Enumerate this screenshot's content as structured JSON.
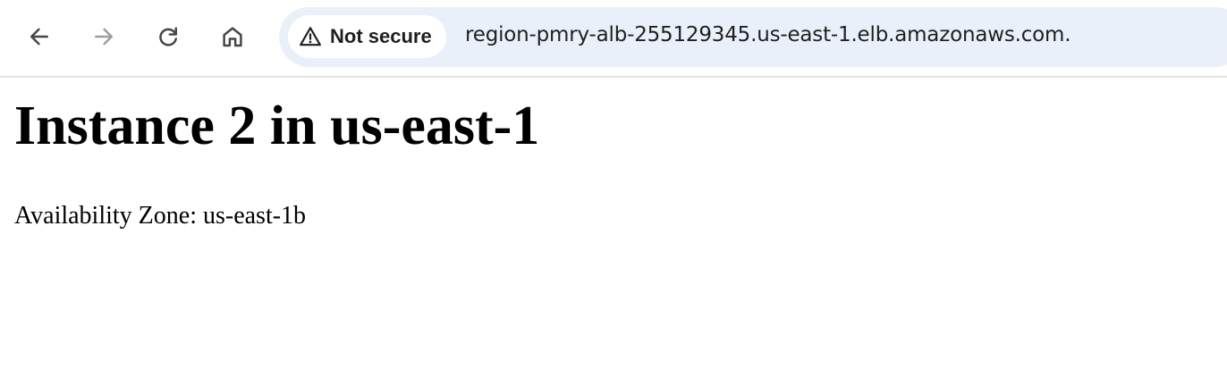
{
  "browser": {
    "nav": {
      "back_icon": "arrow-left-icon",
      "forward_icon": "arrow-right-icon",
      "reload_icon": "reload-icon",
      "home_icon": "home-icon"
    },
    "security": {
      "icon": "warning-triangle-icon",
      "label": "Not secure"
    },
    "url": "region-pmry-alb-255129345.us-east-1.elb.amazonaws.com."
  },
  "page": {
    "heading": "Instance 2 in us-east-1",
    "az_text": "Availability Zone: us-east-1b"
  },
  "colors": {
    "omnibox_bg": "#eaf0f9",
    "icon_active": "#474747",
    "icon_disabled": "#9e9e9e"
  }
}
